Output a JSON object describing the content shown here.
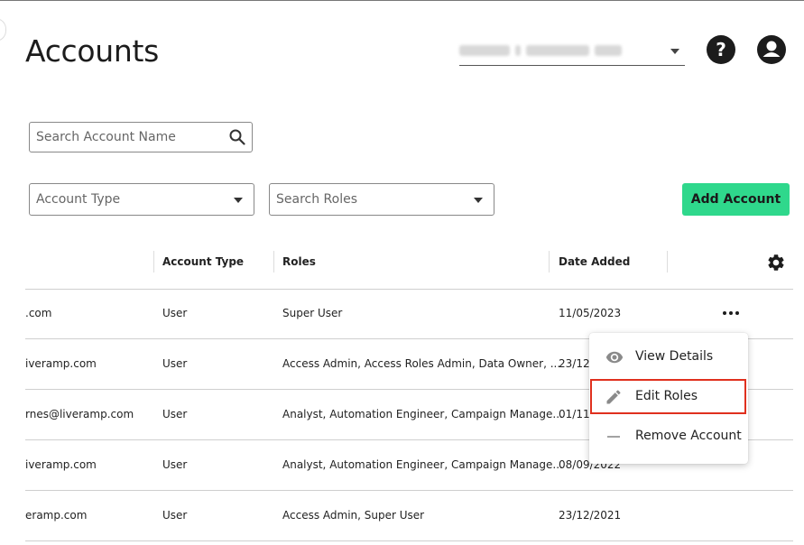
{
  "page": {
    "title": "Accounts"
  },
  "header": {
    "org_select_value": "",
    "help_symbol": "?"
  },
  "search": {
    "placeholder": "Search Account Name"
  },
  "filters": {
    "account_type_label": "Account Type",
    "roles_label": "Search Roles"
  },
  "actions": {
    "add_account_label": "Add Account"
  },
  "table": {
    "columns": [
      "Account Type",
      "Roles",
      "Date Added"
    ],
    "rows": [
      {
        "email": ".com",
        "type": "User",
        "roles": "Super User",
        "date": "11/05/2023"
      },
      {
        "email": "iveramp.com",
        "type": "User",
        "roles": "Access Admin, Access Roles Admin, Data Owner, ...",
        "date": "23/12/"
      },
      {
        "email": "rnes@liveramp.com",
        "type": "User",
        "roles": "Analyst, Automation Engineer, Campaign Manage...",
        "date": "01/11/"
      },
      {
        "email": "iveramp.com",
        "type": "User",
        "roles": "Analyst, Automation Engineer, Campaign Manage...",
        "date": "08/09/2022"
      },
      {
        "email": "eramp.com",
        "type": "User",
        "roles": "Access Admin, Super User",
        "date": "23/12/2021"
      }
    ]
  },
  "row_menu": {
    "items": [
      {
        "label": "View Details",
        "icon": "eye-icon"
      },
      {
        "label": "Edit Roles",
        "icon": "pencil-icon"
      },
      {
        "label": "Remove Account",
        "icon": "minus-icon"
      }
    ],
    "highlighted_item": "Edit Roles",
    "highlight_color": "#e0301e"
  },
  "colors": {
    "accent": "#2fd88c",
    "text": "#1c1c1c"
  }
}
